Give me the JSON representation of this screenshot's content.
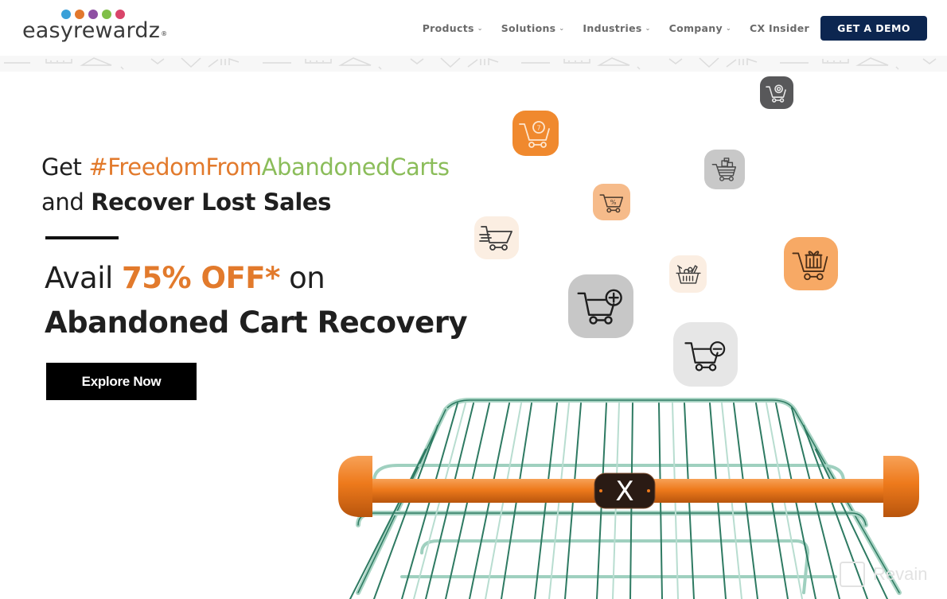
{
  "brand": {
    "name": "easyrewardz",
    "registered_mark": "®",
    "dot_colors": [
      "#3aa0d8",
      "#e2782d",
      "#8e4fa3",
      "#7fbf48",
      "#d9456a"
    ]
  },
  "nav": {
    "items": [
      {
        "label": "Products",
        "has_dropdown": true
      },
      {
        "label": "Solutions",
        "has_dropdown": true
      },
      {
        "label": "Industries",
        "has_dropdown": true
      },
      {
        "label": "Company",
        "has_dropdown": true
      },
      {
        "label": "CX Insider",
        "has_dropdown": false
      }
    ],
    "chevron": "⌄",
    "cta_label": "GET A DEMO"
  },
  "hero": {
    "line1_prefix": "Get ",
    "hashtag_part1": "#FreedomFrom",
    "hashtag_part2": "AbandonedCarts",
    "line2_prefix": "and ",
    "line2_bold": "Recover Lost Sales",
    "offer_prefix": "Avail ",
    "offer_highlight": "75% OFF*",
    "offer_suffix": " on",
    "offer_line2": "Abandoned Cart Recovery",
    "cta_label": "Explore Now"
  },
  "floating_icons": [
    {
      "name": "cart-clock-icon",
      "bg": "#f0892e"
    },
    {
      "name": "cart-coin-icon",
      "bg": "#58585a"
    },
    {
      "name": "cart-boxes-icon",
      "bg": "#c8c8c8"
    },
    {
      "name": "cart-percent-icon",
      "bg": "#f6bb8a"
    },
    {
      "name": "fast-cart-icon",
      "bg": "#fbeee2"
    },
    {
      "name": "cart-gift-icon",
      "bg": "#f7a965"
    },
    {
      "name": "grocery-basket-icon",
      "bg": "#fbeee2"
    },
    {
      "name": "cart-add-icon",
      "bg": "#c7c7c7"
    },
    {
      "name": "cart-remove-icon",
      "bg": "#e6e6e6"
    }
  ],
  "cart_handle_badge": "X",
  "watermark": "Revain",
  "colors": {
    "accent_orange": "#e27a2c",
    "accent_green": "#8bbd5a",
    "demo_button": "#0c2650",
    "cart_wire": "#2e7a62",
    "handle_orange": "#ee7a1c"
  }
}
